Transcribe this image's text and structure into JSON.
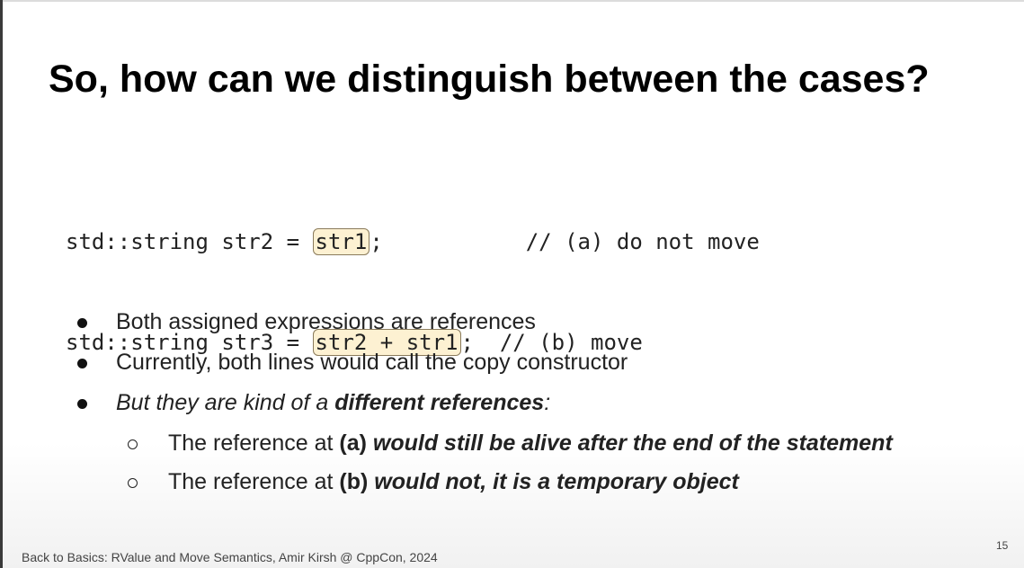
{
  "slide": {
    "title": "So, how can we distinguish between the cases?",
    "code": {
      "line1": {
        "prefix": "std::string str2 = ",
        "highlight": "str1",
        "suffix": ";           // (a) do not move"
      },
      "line2": {
        "prefix": "std::string str3 = ",
        "highlight": "str2 + str1",
        "suffix": ";  // (b) move"
      },
      "highlight_color": "#fdf1d2"
    },
    "bullets": {
      "b1": "Both assigned expressions are references",
      "b2": "Currently, both lines would call the copy constructor",
      "b3": {
        "lead": "But they are kind of a ",
        "bold": "different references",
        "tail": ":"
      }
    },
    "sub_bullets": {
      "s1": {
        "lead": "The reference at ",
        "label": "(a)",
        "emph": " would still be alive after the end of the statement"
      },
      "s2": {
        "lead": "The reference at ",
        "label": "(b)",
        "emph": " would not, it is a temporary object"
      }
    },
    "footer": "Back to Basics: RValue and Move Semantics, Amir Kirsh @ CppCon, 2024",
    "page_number": "15"
  }
}
